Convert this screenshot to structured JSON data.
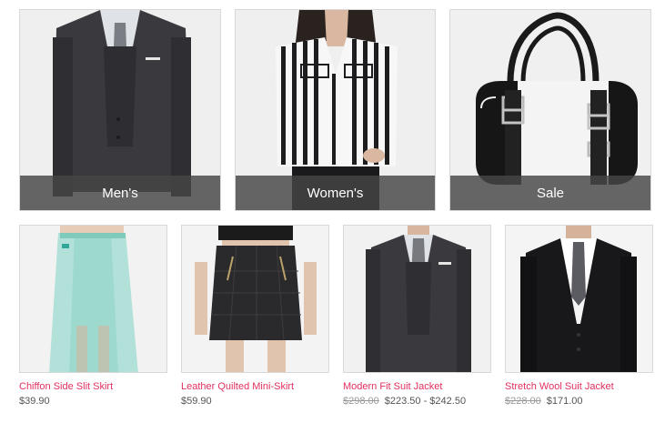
{
  "colors": {
    "product_link": "#e0305f",
    "price_text": "#555555",
    "old_price_text": "#9a9a9a",
    "category_overlay": "#464646"
  },
  "categories": [
    {
      "label": "Men's"
    },
    {
      "label": "Women's"
    },
    {
      "label": "Sale"
    }
  ],
  "products": [
    {
      "name": "Chiffon Side Slit Skirt",
      "price": "$39.90"
    },
    {
      "name": "Leather Quilted Mini-Skirt",
      "price": "$59.90"
    },
    {
      "name": "Modern Fit Suit Jacket",
      "old_price": "$298.00",
      "price": "$223.50 - $242.50"
    },
    {
      "name": "Stretch Wool Suit Jacket",
      "old_price": "$228.00",
      "price": "$171.00"
    }
  ]
}
